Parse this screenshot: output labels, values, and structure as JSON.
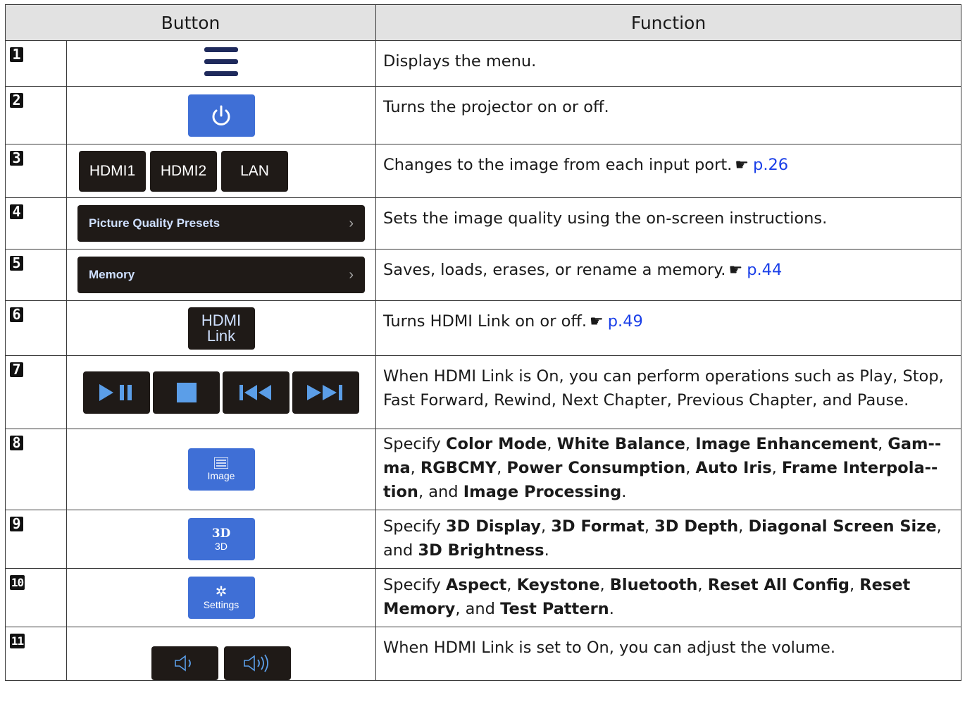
{
  "header": {
    "button": "Button",
    "function": "Function"
  },
  "colors": {
    "dark_button": "#1f1a17",
    "blue_button": "#3f6fd6",
    "link": "#1a3fe8",
    "header_bg": "#e2e2e2"
  },
  "rows": [
    {
      "num": "1",
      "icon": "menu-icon",
      "function": "Displays the menu."
    },
    {
      "num": "2",
      "icon": "power-icon",
      "function": "Turns the projector on or off."
    },
    {
      "num": "3",
      "buttons": [
        "HDMI1",
        "HDMI2",
        "LAN"
      ],
      "function": "Changes to the image from each input port.",
      "link": "p.26"
    },
    {
      "num": "4",
      "label": "Picture Quality Presets",
      "chevron": "›",
      "function": "Sets the image quality using the on-screen instructions."
    },
    {
      "num": "5",
      "label": "Memory",
      "chevron": "›",
      "function": "Saves, loads, erases, or rename a memory.",
      "link": "p.44"
    },
    {
      "num": "6",
      "label_line1": "HDMI",
      "label_line2": "Link",
      "function": "Turns HDMI Link on or off.",
      "link": "p.49"
    },
    {
      "num": "7",
      "icons": [
        "play-pause-icon",
        "stop-icon",
        "previous-icon",
        "next-icon"
      ],
      "function": "When HDMI Link is On, you can perform operations such as Play, Stop, Fast Forward, Rewind, Next Chapter, Previous Chapter, and Pause."
    },
    {
      "num": "8",
      "label": "Image",
      "icon": "sliders-icon",
      "f": [
        "Specify ",
        "Color Mode",
        ", ",
        "White Balance",
        ", ",
        "Image Enhancement",
        ", ",
        "Gam-­ma",
        ", ",
        "RGBCMY",
        ", ",
        "Power Consumption",
        ", ",
        "Auto Iris",
        ", ",
        "Frame Interpola-­tion",
        ", and ",
        "Image Processing",
        "."
      ]
    },
    {
      "num": "9",
      "label": "3D",
      "icon_text": "3D",
      "f": [
        "Specify ",
        "3D Display",
        ", ",
        "3D Format",
        ", ",
        "3D Depth",
        ", ",
        "Diagonal Screen Size",
        ", and ",
        "3D Brightness",
        "."
      ]
    },
    {
      "num": "10",
      "label": "Settings",
      "icon": "gear-icon",
      "f": [
        "Specify ",
        "Aspect",
        ", ",
        "Keystone",
        ", ",
        "Bluetooth",
        ", ",
        "Reset All Config",
        ", ",
        "Reset Memory",
        ", and ",
        "Test Pattern",
        "."
      ]
    },
    {
      "num": "11",
      "icons": [
        "volume-down-icon",
        "volume-up-icon"
      ],
      "function": "When HDMI Link is set to On, you can adjust the volume."
    }
  ]
}
